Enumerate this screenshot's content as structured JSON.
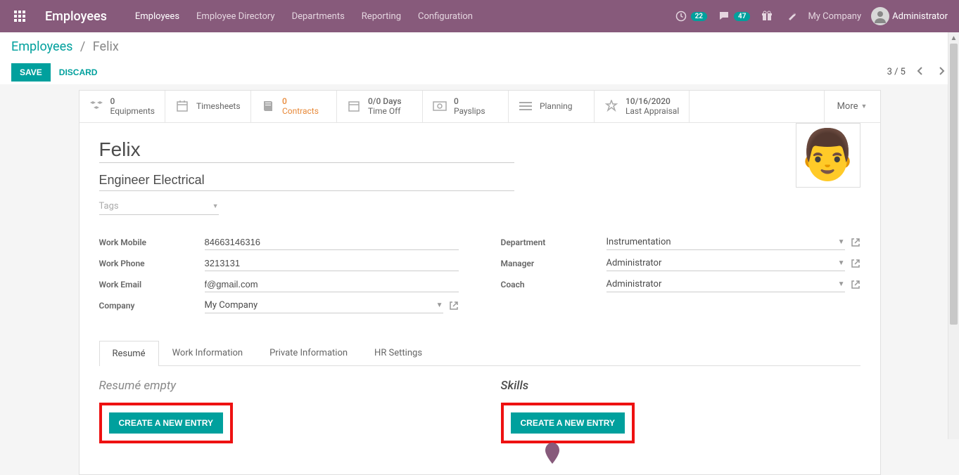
{
  "topbar": {
    "brand": "Employees",
    "nav": [
      "Employees",
      "Employee Directory",
      "Departments",
      "Reporting",
      "Configuration"
    ],
    "badge_clock": "22",
    "badge_chat": "47",
    "company": "My Company",
    "user": "Administrator"
  },
  "breadcrumb": {
    "root": "Employees",
    "current": "Felix"
  },
  "buttons": {
    "save": "SAVE",
    "discard": "DISCARD"
  },
  "pager": {
    "text": "3 / 5"
  },
  "stats": {
    "equipments": {
      "value": "0",
      "label": "Equipments"
    },
    "timesheets": {
      "label": "Timesheets"
    },
    "contracts": {
      "value": "0",
      "label": "Contracts"
    },
    "timeoff": {
      "value": "0/0 Days",
      "label": "Time Off"
    },
    "payslips": {
      "value": "0",
      "label": "Payslips"
    },
    "planning": {
      "label": "Planning"
    },
    "appraisal": {
      "value": "10/16/2020",
      "label": "Last Appraisal"
    },
    "more": "More"
  },
  "employee": {
    "name": "Felix",
    "job_title": "Engineer Electrical",
    "tags_placeholder": "Tags"
  },
  "fields": {
    "work_mobile_label": "Work Mobile",
    "work_mobile": "84663146316",
    "work_phone_label": "Work Phone",
    "work_phone": "3213131",
    "work_email_label": "Work Email",
    "work_email": "f@gmail.com",
    "company_label": "Company",
    "company": "My Company",
    "department_label": "Department",
    "department": "Instrumentation",
    "manager_label": "Manager",
    "manager": "Administrator",
    "coach_label": "Coach",
    "coach": "Administrator"
  },
  "tabs": [
    "Resumé",
    "Work Information",
    "Private Information",
    "HR Settings"
  ],
  "resume_section": {
    "title": "Resumé empty",
    "create_btn": "CREATE A NEW ENTRY"
  },
  "skills_section": {
    "title": "Skills",
    "create_btn": "CREATE A NEW ENTRY"
  }
}
